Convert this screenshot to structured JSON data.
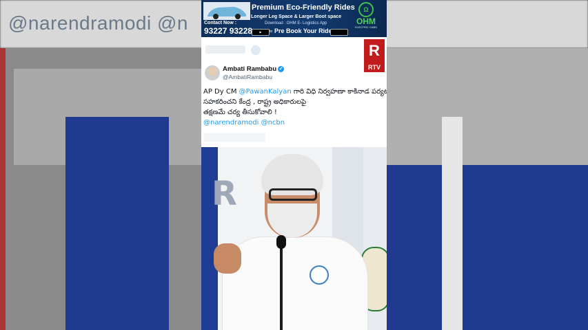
{
  "background": {
    "top_text": "@narendramodi @n"
  },
  "ad": {
    "title": "Premium Eco-Friendly Rides",
    "subtitle": "Longer Leg Space & Larger Boot space",
    "contact_label": "Contact Now :",
    "phone": "93227 93228",
    "download_text": "Download : OHM E- Logistics App",
    "to": "to",
    "prebook": "Pre Book Your Ride",
    "brand": "OHM",
    "brand_sub": "ELECTRIC CABS"
  },
  "channel_logo": {
    "letter": "R",
    "name": "RTV"
  },
  "tweet": {
    "author_name": "Ambati Rambabu",
    "author_handle": "@AmbatiRambabu",
    "line1_prefix": "AP Dy CM ",
    "line1_mention": "@PawanKalyan",
    "line1_rest": " గారి విధి నిర్వహణా కాకినాడ పర్యటనకు",
    "line2": "సహకరించని కేంద్ర , రాష్ట్ర అధికారులపై",
    "line3": "తక్షణమే చర్య తీసుకోవాలి !",
    "line4": "@narendramodi @ncbn"
  },
  "colors": {
    "accent_blue": "#1d9bf0",
    "rtv_red": "#c21b1b",
    "ad_bg": "#123a70",
    "ohm_green": "#4fd25a"
  }
}
